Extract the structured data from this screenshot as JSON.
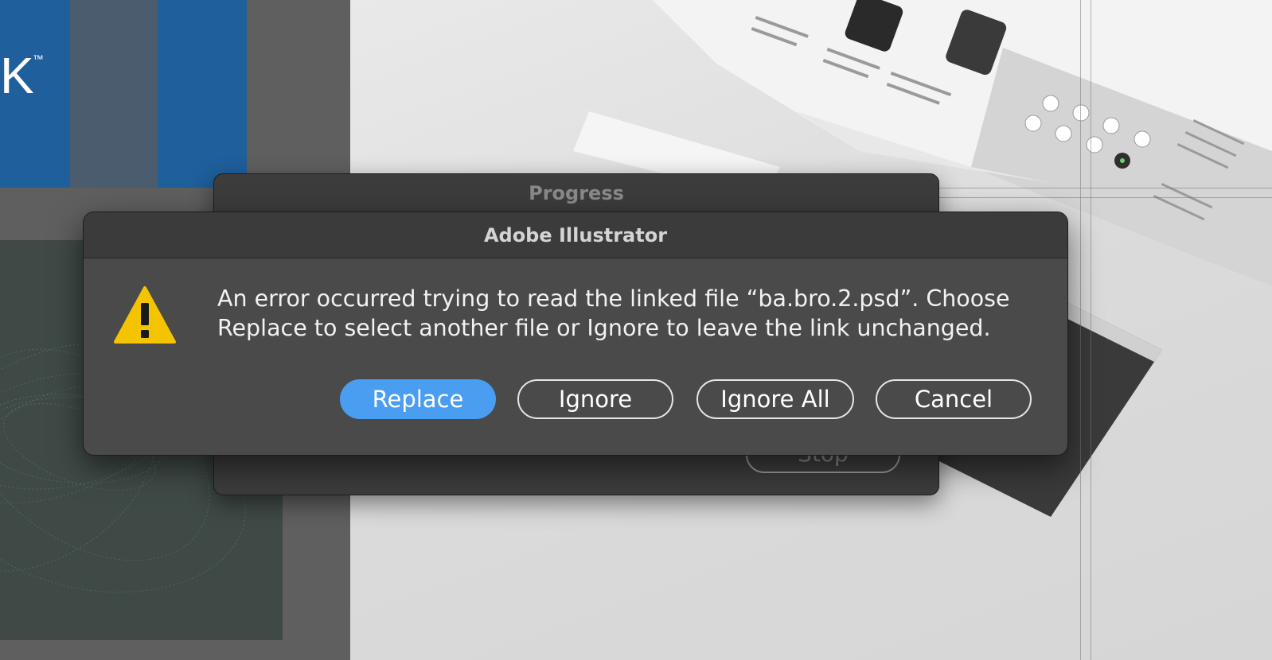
{
  "background": {
    "logo_fragment": "K",
    "logo_trademark": "™"
  },
  "progress_dialog": {
    "title": "Progress",
    "stop_label": "Stop"
  },
  "alert_dialog": {
    "title": "Adobe Illustrator",
    "icon": "warning-icon",
    "message": "An error occurred trying to read the linked file “ba.bro.2.psd”. Choose Replace to select another file or Ignore to leave the link unchanged.",
    "buttons": {
      "replace": "Replace",
      "ignore": "Ignore",
      "ignore_all": "Ignore All",
      "cancel": "Cancel"
    },
    "colors": {
      "primary_button": "#4a9ef2",
      "warning": "#f5c400"
    }
  }
}
